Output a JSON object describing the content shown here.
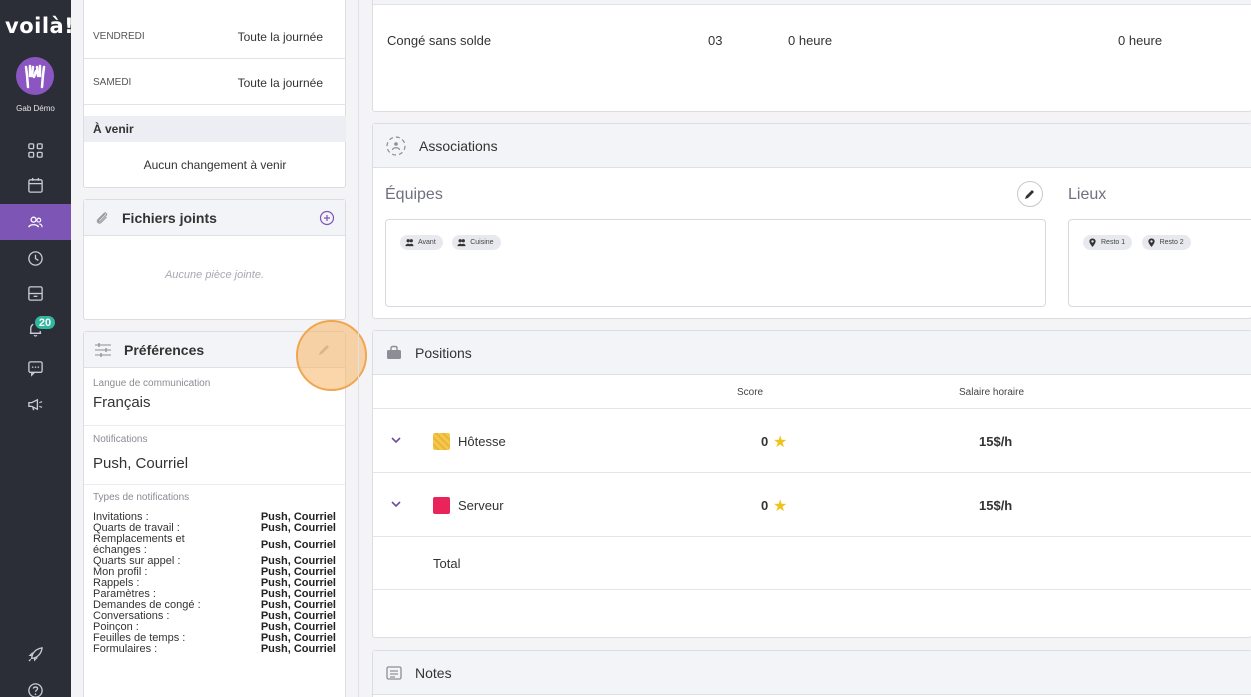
{
  "app": {
    "logo": "voilà!",
    "user_name": "Gab Démo",
    "notification_count": "20",
    "nav": [
      {
        "icon": "dashboard-icon"
      },
      {
        "icon": "calendar-icon"
      },
      {
        "icon": "users-icon",
        "active": true
      },
      {
        "icon": "clock-icon"
      },
      {
        "icon": "inbox-icon"
      },
      {
        "icon": "bell-icon"
      },
      {
        "icon": "chat-icon"
      },
      {
        "icon": "megaphone-icon"
      },
      {
        "icon": "rocket-icon"
      },
      {
        "icon": "help-icon"
      }
    ],
    "accent": "#7d55b5"
  },
  "schedule": {
    "rows": [
      {
        "day": "VENDREDI",
        "value": "Toute la journée"
      },
      {
        "day": "SAMEDI",
        "value": "Toute la journée"
      }
    ],
    "upcoming_title": "À venir",
    "upcoming_text": "Aucun changement à venir"
  },
  "attachments": {
    "title": "Fichiers joints",
    "empty": "Aucune pièce jointe."
  },
  "preferences": {
    "title": "Préférences",
    "language_label": "Langue de communication",
    "language_value": "Français",
    "notifications_label": "Notifications",
    "notifications_value": "Push, Courriel",
    "types_label": "Types de notifications",
    "types": [
      {
        "name": "Invitations :",
        "value": "Push, Courriel"
      },
      {
        "name": "Quarts de travail :",
        "value": "Push, Courriel"
      },
      {
        "name": "Remplacements et échanges :",
        "value": "Push, Courriel"
      },
      {
        "name": "Quarts sur appel :",
        "value": "Push, Courriel"
      },
      {
        "name": "Mon profil :",
        "value": "Push, Courriel"
      },
      {
        "name": "Rappels :",
        "value": "Push, Courriel"
      },
      {
        "name": "Paramètres :",
        "value": "Push, Courriel"
      },
      {
        "name": "Demandes de congé :",
        "value": "Push, Courriel"
      },
      {
        "name": "Conversations :",
        "value": "Push, Courriel"
      },
      {
        "name": "Poinçon :",
        "value": "Push, Courriel"
      },
      {
        "name": "Feuilles de temps :",
        "value": "Push, Courriel"
      },
      {
        "name": "Formulaires :",
        "value": "Push, Courriel"
      }
    ]
  },
  "leave": {
    "type": "Congé sans solde",
    "code": "03",
    "hours1": "0 heure",
    "hours2": "0 heure"
  },
  "associations": {
    "title": "Associations",
    "teams_title": "Équipes",
    "teams": [
      "Avant",
      "Cuisine"
    ],
    "places_title": "Lieux",
    "places": [
      "Resto 1",
      "Resto 2"
    ]
  },
  "positions": {
    "title": "Positions",
    "col_score": "Score",
    "col_wage": "Salaire horaire",
    "rows": [
      {
        "name": "Hôtesse",
        "score": "0",
        "wage": "15$/h",
        "color": "#f5c84c"
      },
      {
        "name": "Serveur",
        "score": "0",
        "wage": "15$/h",
        "color": "#e8245a"
      }
    ],
    "total_label": "Total"
  },
  "notes": {
    "title": "Notes"
  }
}
